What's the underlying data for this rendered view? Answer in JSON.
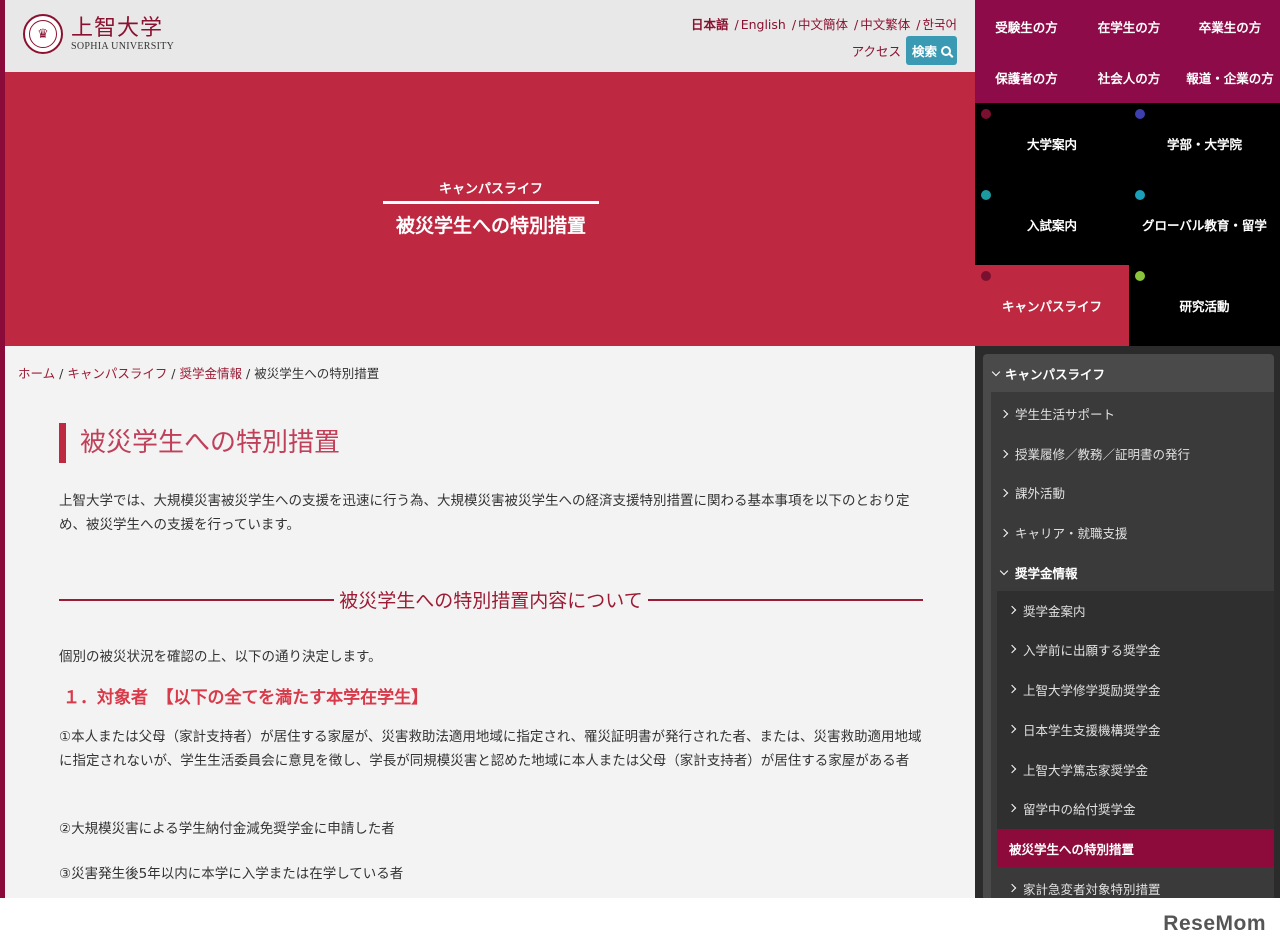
{
  "header": {
    "logo_mark": "♛",
    "logo_ja": "上智大学",
    "logo_en": "SOPHIA UNIVERSITY",
    "languages": [
      "日本語",
      "English",
      "中文簡体",
      "中文繁体",
      "한국어"
    ],
    "access": "アクセス",
    "search": "検索"
  },
  "audience_nav": [
    "受験生の方",
    "在学生の方",
    "卒業生の方",
    "保護者の方",
    "社会人の方",
    "報道・企業の方"
  ],
  "main_nav": [
    {
      "label": "大学案内",
      "dot": "#7a1030"
    },
    {
      "label": "学部・大学院",
      "dot": "#3b3fb0"
    },
    {
      "label": "入試案内",
      "dot": "#1a9aa0"
    },
    {
      "label": "グローバル教育・留学",
      "dot": "#1aa0b8"
    },
    {
      "label": "キャンパスライフ",
      "dot": "#7a1030"
    },
    {
      "label": "研究活動",
      "dot": "#8ac43a"
    }
  ],
  "hero": {
    "category": "キャンパスライフ",
    "title": "被災学生への特別措置"
  },
  "breadcrumb": {
    "home": "ホーム",
    "level1": "キャンパスライフ",
    "level2": "奨学金情報",
    "current": "被災学生への特別措置",
    "sep": " / "
  },
  "content": {
    "page_title": "被災学生への特別措置",
    "intro": "上智大学では、大規模災害被災学生への支援を迅速に行う為、大規模災害被災学生への経済支援特別措置に関わる基本事項を以下のとおり定め、被災学生への支援を行っています。",
    "section_title": "被災学生への特別措置内容について",
    "lead": "個別の被災状況を確認の上、以下の通り決定します。",
    "h3": "１．対象者　【以下の全てを満たす本学在学生】",
    "conditions": [
      "①本人または父母（家計支持者）が居住する家屋が、災害救助法適用地域に指定され、罹災証明書が発行された者、または、災害救助適用地域に指定されないが、学生生活委員会に意見を徴し、学長が同規模災害と認めた地域に本人または父母（家計支持者）が居住する家屋がある者",
      "②大規模災害による学生納付金減免奨学金に申請した者",
      "③災害発生後5年以内に本学に入学または在学している者"
    ]
  },
  "sidebar": {
    "title": "キャンパスライフ",
    "items": [
      "学生生活サポート",
      "授業履修／教務／証明書の発行",
      "課外活動",
      "キャリア・就職支援"
    ],
    "open_item": "奨学金情報",
    "sub_items": [
      "奨学金案内",
      "入学前に出願する奨学金",
      "上智大学修学奨励奨学金",
      "日本学生支援機構奨学金",
      "上智大学篤志家奨学金",
      "留学中の給付奨学金",
      "被災学生への特別措置",
      "家計急変者対象特別措置"
    ],
    "active_sub": 6
  },
  "footer": {
    "brand": "ReseMom"
  }
}
